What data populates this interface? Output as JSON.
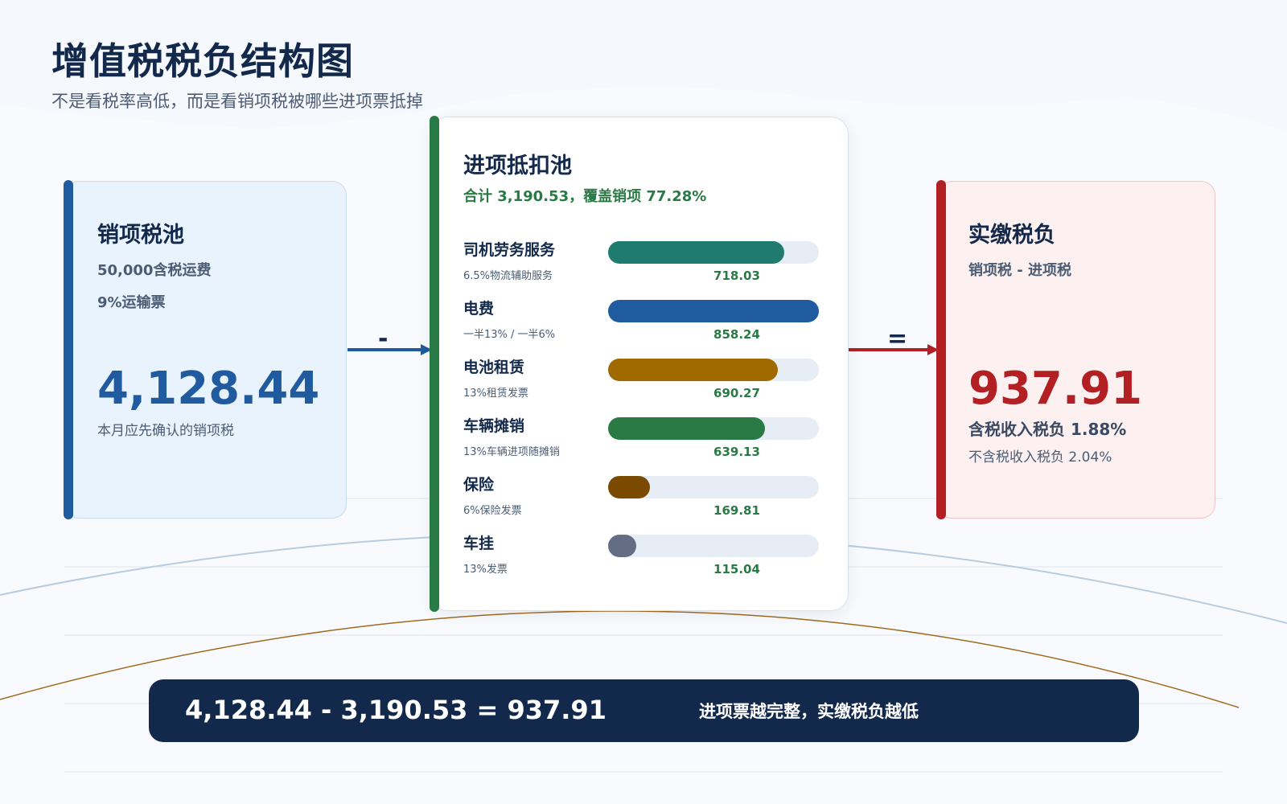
{
  "header": {
    "title": "增值税税负结构图",
    "subtitle": "不是看税率高低，而是看销项税被哪些进项票抵掉"
  },
  "output_pool": {
    "title": "销项税池",
    "line1": "50,000含税运费",
    "line2": "9%运输票",
    "amount": "4,128.44",
    "caption": "本月应先确认的销项税"
  },
  "operators": {
    "minus": "-",
    "equals": "="
  },
  "input_pool": {
    "title": "进项抵扣池",
    "summary": "合计 3,190.53，覆盖销项 77.28%",
    "items": [
      {
        "name": "司机劳务服务",
        "note": "6.5%物流辅助服务",
        "value": "718.03",
        "amount": 718.03,
        "color": "#1e7b6e"
      },
      {
        "name": "电费",
        "note": "一半13% / 一半6%",
        "value": "858.24",
        "amount": 858.24,
        "color": "#1f5b9e"
      },
      {
        "name": "电池租赁",
        "note": "13%租赁发票",
        "value": "690.27",
        "amount": 690.27,
        "color": "#a06a00"
      },
      {
        "name": "车辆摊销",
        "note": "13%车辆进项随摊销",
        "value": "639.13",
        "amount": 639.13,
        "color": "#2a7a45"
      },
      {
        "name": "保险",
        "note": "6%保险发票",
        "value": "169.81",
        "amount": 169.81,
        "color": "#7a4a00"
      },
      {
        "name": "车挂",
        "note": "13%发票",
        "value": "115.04",
        "amount": 115.04,
        "color": "#636e84"
      }
    ]
  },
  "tax_payable": {
    "title": "实缴税负",
    "formula": "销项税 - 进项税",
    "amount": "937.91",
    "rate_incl": "含税收入税负 1.88%",
    "rate_excl": "不含税收入税负 2.04%"
  },
  "bottom": {
    "equation": "4,128.44 - 3,190.53 = 937.91",
    "note": "进项票越完整，实缴税负越低"
  },
  "colors": {
    "navy": "#13294b",
    "blue": "#1f5b9e",
    "green": "#2a7a45",
    "red": "#b22024",
    "track": "#e6edf5"
  }
}
